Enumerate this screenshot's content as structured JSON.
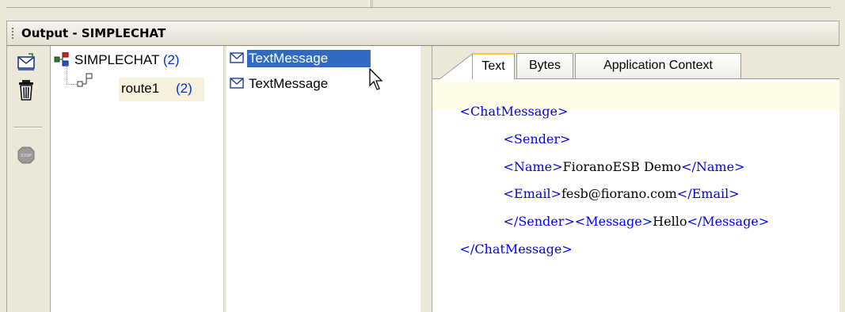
{
  "window": {
    "title": "Output - SIMPLECHAT"
  },
  "toolbar": {
    "buttons": [
      {
        "name": "send-message-icon",
        "tooltip": ""
      },
      {
        "name": "trash-icon",
        "tooltip": ""
      },
      {
        "name": "stop-icon",
        "tooltip": ""
      }
    ]
  },
  "tree": {
    "root": {
      "label": "SIMPLECHAT",
      "count": "(2)"
    },
    "child": {
      "label": "route1",
      "count": "(2)"
    }
  },
  "messages": {
    "items": [
      {
        "label": "TextMessage",
        "selected": true
      },
      {
        "label": "TextMessage",
        "selected": false
      }
    ]
  },
  "tabs": [
    {
      "label": "Text",
      "active": true
    },
    {
      "label": "Bytes",
      "active": false
    },
    {
      "label": "Application Context",
      "active": false
    }
  ],
  "xml": {
    "l1_open": "<ChatMessage>",
    "l2_open": "<Sender>",
    "l3_open": "<Name>",
    "l3_text": "FioranoESB Demo",
    "l3_close": "</Name>",
    "l4_open": "<Email>",
    "l4_text": "fesb@fiorano.com",
    "l4_close": "</Email>",
    "l5_close": "</Sender>",
    "l5_open2": "<Message>",
    "l5_text": "Hello",
    "l5_close2": "</Message>",
    "l6_close": "</ChatMessage>"
  },
  "colors": {
    "selection": "#316ac5",
    "xml_tag": "#0000ee",
    "count_blue": "#0033cc",
    "active_tab_accent": "#ffc83c"
  }
}
